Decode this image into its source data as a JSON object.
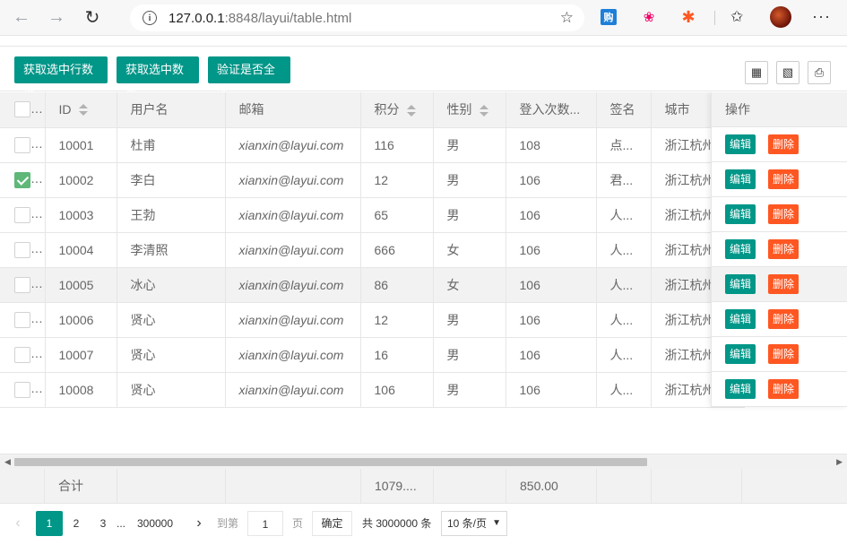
{
  "browser": {
    "url_host": "127.0.0.1",
    "url_port": ":8848",
    "url_path": "/layui/table.html",
    "ext1_label": "购"
  },
  "toolbar": {
    "btn_get_rows": "获取选中行数据",
    "btn_get_count": "获取选中数目",
    "btn_check_all": "验证是否全选"
  },
  "table": {
    "headers": {
      "id": "ID",
      "username": "用户名",
      "email": "邮箱",
      "score": "积分",
      "sex": "性别",
      "logins": "登入次数...",
      "sign": "签名",
      "city": "城市",
      "ops": "操作"
    },
    "rows": [
      {
        "id": "10001",
        "username": "杜甫",
        "email": "xianxin@layui.com",
        "score": "116",
        "sex": "男",
        "logins": "108",
        "sign": "点...",
        "city": "浙江杭州",
        "checked": false
      },
      {
        "id": "10002",
        "username": "李白",
        "email": "xianxin@layui.com",
        "score": "12",
        "sex": "男",
        "logins": "106",
        "sign": "君...",
        "city": "浙江杭州",
        "checked": true
      },
      {
        "id": "10003",
        "username": "王勃",
        "email": "xianxin@layui.com",
        "score": "65",
        "sex": "男",
        "logins": "106",
        "sign": "人...",
        "city": "浙江杭州",
        "checked": false
      },
      {
        "id": "10004",
        "username": "李清照",
        "email": "xianxin@layui.com",
        "score": "666",
        "sex": "女",
        "logins": "106",
        "sign": "人...",
        "city": "浙江杭州",
        "checked": false
      },
      {
        "id": "10005",
        "username": "冰心",
        "email": "xianxin@layui.com",
        "score": "86",
        "sex": "女",
        "logins": "106",
        "sign": "人...",
        "city": "浙江杭州",
        "checked": false
      },
      {
        "id": "10006",
        "username": "贤心",
        "email": "xianxin@layui.com",
        "score": "12",
        "sex": "男",
        "logins": "106",
        "sign": "人...",
        "city": "浙江杭州",
        "checked": false
      },
      {
        "id": "10007",
        "username": "贤心",
        "email": "xianxin@layui.com",
        "score": "16",
        "sex": "男",
        "logins": "106",
        "sign": "人...",
        "city": "浙江杭州",
        "checked": false
      },
      {
        "id": "10008",
        "username": "贤心",
        "email": "xianxin@layui.com",
        "score": "106",
        "sex": "男",
        "logins": "106",
        "sign": "人...",
        "city": "浙江杭州",
        "checked": false
      }
    ],
    "edit_label": "编辑",
    "delete_label": "删除",
    "total_label": "合计",
    "total_score": "1079....",
    "total_logins": "850.00"
  },
  "pager": {
    "current": "1",
    "p2": "2",
    "p3": "3",
    "dots": "...",
    "last": "300000",
    "goto_label": "到第",
    "goto_value": "1",
    "page_unit": "页",
    "confirm": "确定",
    "total_text": "共 3000000 条",
    "page_size": "10 条/页"
  }
}
